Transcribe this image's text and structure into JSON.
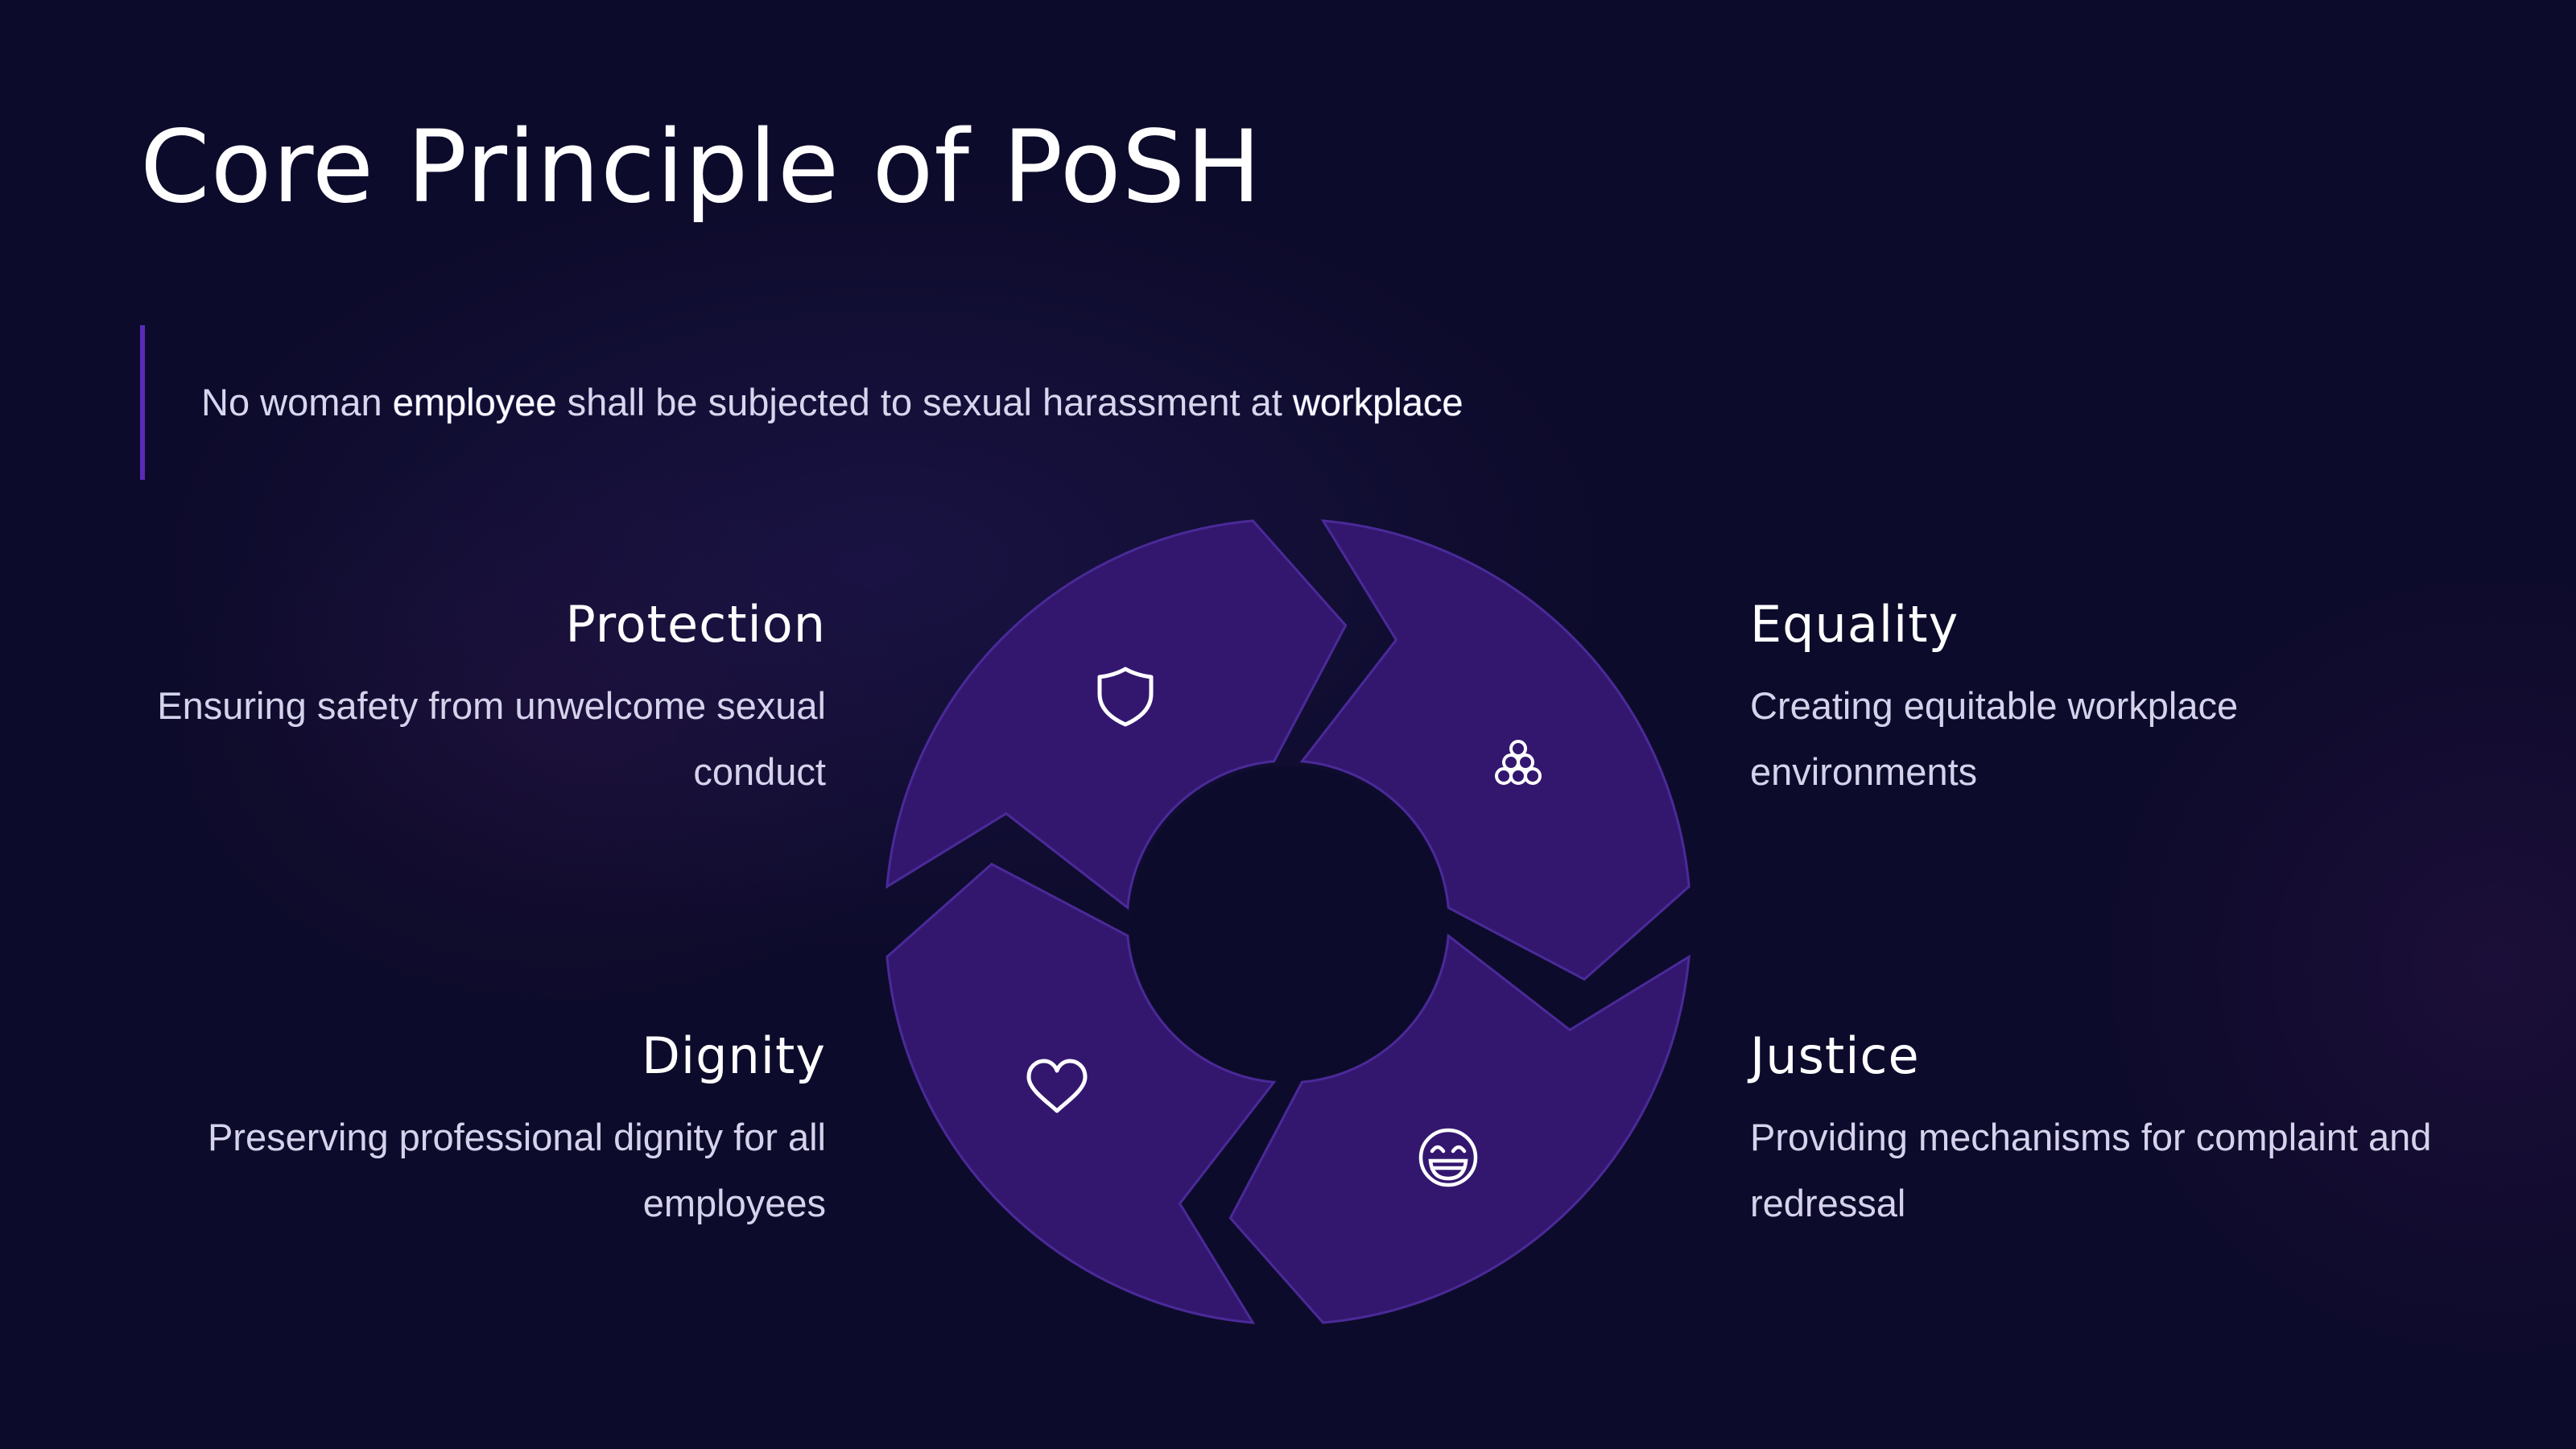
{
  "title": "Core Principle of PoSH",
  "quote": {
    "part1": "No woman ",
    "highlight1": "employee",
    "part2": " shall be subjected to sexual harassment at ",
    "highlight2": "workplace"
  },
  "principles": [
    {
      "title": "Protection",
      "description": "Ensuring safety from unwelcome sexual conduct",
      "icon": "shield-icon"
    },
    {
      "title": "Equality",
      "description": "Creating equitable workplace environments",
      "icon": "people-group-icon"
    },
    {
      "title": "Justice",
      "description": "Providing mechanisms for complaint and redressal",
      "icon": "grinning-face-icon"
    },
    {
      "title": "Dignity",
      "description": "Preserving professional dignity for all employees",
      "icon": "heart-icon"
    }
  ],
  "colors": {
    "background": "#0d0b2b",
    "segment_fill": "#33176f",
    "segment_stroke": "#4a2a98",
    "accent_bar": "#5b2bb8",
    "text": "#ffffff",
    "muted_text": "#d5d3ec"
  }
}
